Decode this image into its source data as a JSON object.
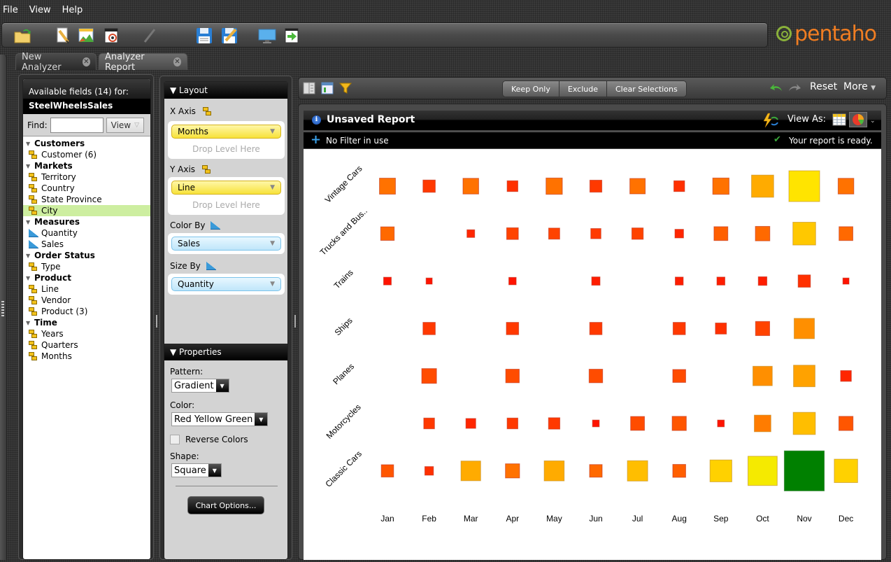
{
  "menu": {
    "items": [
      "File",
      "View",
      "Help"
    ]
  },
  "toolbar": {
    "icons": [
      "open-folder-icon",
      "edit-report-icon",
      "analyzer-report-icon",
      "dashboard-icon",
      "pencil-icon",
      "save-icon",
      "save-as-icon",
      "display-icon",
      "export-icon"
    ]
  },
  "brand": {
    "logo_text": "pentaho",
    "logo_color": "#f07d22",
    "swirl_color": "#8ab13b"
  },
  "tabs": [
    {
      "label": "New Analyzer",
      "active": false
    },
    {
      "label": "Analyzer Report",
      "active": true
    }
  ],
  "fields": {
    "header": "Available fields (14) for:",
    "cube": "SteelWheelsSales",
    "find_label": "Find:",
    "find_value": "",
    "view_label": "View",
    "groups": [
      {
        "name": "Customers",
        "items": [
          {
            "label": "Customer (6)",
            "type": "level"
          }
        ]
      },
      {
        "name": "Markets",
        "items": [
          {
            "label": "Territory",
            "type": "level"
          },
          {
            "label": "Country",
            "type": "level"
          },
          {
            "label": "State Province",
            "type": "level"
          },
          {
            "label": "City",
            "type": "level",
            "selected": true
          }
        ]
      },
      {
        "name": "Measures",
        "items": [
          {
            "label": "Quantity",
            "type": "measure"
          },
          {
            "label": "Sales",
            "type": "measure"
          }
        ]
      },
      {
        "name": "Order Status",
        "items": [
          {
            "label": "Type",
            "type": "level"
          }
        ]
      },
      {
        "name": "Product",
        "items": [
          {
            "label": "Line",
            "type": "level"
          },
          {
            "label": "Vendor",
            "type": "level"
          },
          {
            "label": "Product (3)",
            "type": "level"
          }
        ]
      },
      {
        "name": "Time",
        "items": [
          {
            "label": "Years",
            "type": "level"
          },
          {
            "label": "Quarters",
            "type": "level"
          },
          {
            "label": "Months",
            "type": "level"
          }
        ]
      }
    ]
  },
  "layout": {
    "title": "▼ Layout",
    "x_axis_label": "X Axis",
    "x_axis_value": "Months",
    "y_axis_label": "Y Axis",
    "y_axis_value": "Line",
    "drop_here": "Drop Level Here",
    "color_by_label": "Color By",
    "color_by_value": "Sales",
    "size_by_label": "Size By",
    "size_by_value": "Quantity"
  },
  "properties": {
    "title": "▼ Properties",
    "pattern_label": "Pattern:",
    "pattern_value": "Gradient",
    "color_label": "Color:",
    "color_value": "Red Yellow Green",
    "reverse_label": "Reverse Colors",
    "reverse_checked": false,
    "shape_label": "Shape:",
    "shape_value": "Square",
    "chart_options": "Chart Options..."
  },
  "report_toolbar": {
    "keep_only": "Keep Only",
    "exclude": "Exclude",
    "clear_selections": "Clear Selections",
    "reset": "Reset",
    "more": "More"
  },
  "report": {
    "title": "Unsaved Report",
    "view_as": "View As:",
    "filter_text": "No Filter in use",
    "status": "Your report is ready."
  },
  "chart_data": {
    "type": "heatmap",
    "subtype": "square-size-and-color",
    "x_label": "Months",
    "y_label": "Line",
    "size_measure": "Quantity",
    "color_measure": "Sales",
    "color_scale": [
      "#ff0000",
      "#ffee00",
      "#008000"
    ],
    "color_scale_name": "Red Yellow Green",
    "categories": [
      "Jan",
      "Feb",
      "Mar",
      "Apr",
      "May",
      "Jun",
      "Jul",
      "Aug",
      "Sep",
      "Oct",
      "Nov",
      "Dec"
    ],
    "rows": [
      "Vintage Cars",
      "Trucks and Bus..",
      "Trains",
      "Ships",
      "Planes",
      "Motorcycles",
      "Classic Cars"
    ],
    "note": "size = relative Quantity (0-1), color = relative Sales (0-1), null = no data",
    "size": [
      [
        0.52,
        0.4,
        0.51,
        0.35,
        0.53,
        0.39,
        0.5,
        0.35,
        0.53,
        0.72,
        1.0,
        0.51
      ],
      [
        0.44,
        null,
        0.25,
        0.38,
        0.36,
        0.33,
        0.37,
        0.28,
        0.45,
        0.47,
        0.74,
        0.45
      ],
      [
        0.25,
        0.2,
        null,
        0.24,
        null,
        0.27,
        null,
        0.26,
        0.26,
        0.28,
        0.4,
        0.2
      ],
      [
        null,
        0.4,
        null,
        0.4,
        null,
        0.4,
        null,
        0.4,
        0.36,
        0.46,
        0.66,
        null
      ],
      [
        null,
        0.48,
        null,
        0.44,
        null,
        0.44,
        null,
        0.42,
        null,
        0.63,
        0.7,
        0.35
      ],
      [
        null,
        0.35,
        0.32,
        0.35,
        0.37,
        0.22,
        0.45,
        0.46,
        0.22,
        0.54,
        0.72,
        0.46
      ],
      [
        0.4,
        0.28,
        0.64,
        0.46,
        0.65,
        0.41,
        0.66,
        0.42,
        0.71,
        0.95,
        1.3,
        0.76
      ]
    ],
    "color": [
      [
        0.24,
        0.12,
        0.24,
        0.1,
        0.24,
        0.12,
        0.24,
        0.1,
        0.24,
        0.36,
        0.48,
        0.24
      ],
      [
        0.22,
        null,
        0.08,
        0.14,
        0.14,
        0.12,
        0.14,
        0.08,
        0.2,
        0.22,
        0.42,
        0.22
      ],
      [
        0.04,
        0.04,
        null,
        0.04,
        null,
        0.06,
        null,
        0.06,
        0.06,
        0.06,
        0.1,
        0.04
      ],
      [
        null,
        0.12,
        null,
        0.12,
        null,
        0.12,
        null,
        0.12,
        0.1,
        0.14,
        0.3,
        null
      ],
      [
        null,
        0.16,
        null,
        0.16,
        null,
        0.16,
        null,
        0.16,
        null,
        0.3,
        0.34,
        0.08
      ],
      [
        null,
        0.12,
        0.08,
        0.12,
        0.12,
        0.04,
        0.16,
        0.18,
        0.04,
        0.26,
        0.4,
        0.18
      ],
      [
        0.18,
        0.1,
        0.36,
        0.24,
        0.36,
        0.22,
        0.4,
        0.2,
        0.44,
        0.52,
        1.0,
        0.44
      ]
    ]
  }
}
